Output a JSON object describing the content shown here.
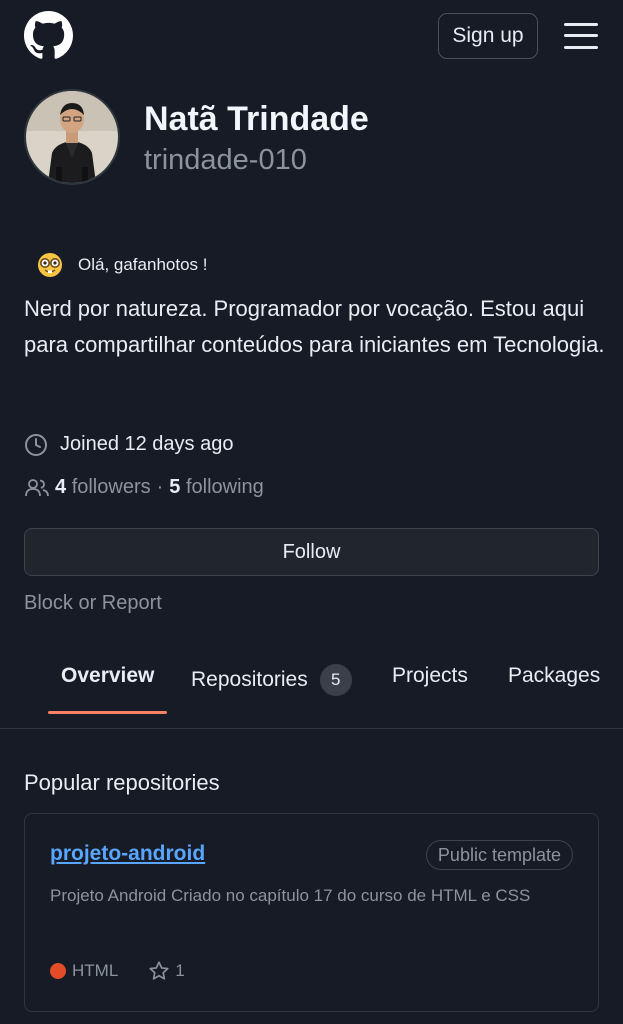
{
  "header": {
    "logo_icon": "github-mark-icon",
    "signup_label": "Sign up",
    "menu_icon": "hamburger-menu-icon"
  },
  "profile": {
    "name": "Natã Trindade",
    "login": "trindade-010",
    "status_emoji": "nerd-face-emoji",
    "status_text": "Olá, gafanhotos !",
    "bio": "Nerd por natureza. Programador por vocação. Estou aqui para compartilhar conteúdos para iniciantes em Tecnologia.",
    "joined": "Joined 12 days ago",
    "followers_count": "4",
    "followers_label": "followers",
    "separator": "·",
    "following_count": "5",
    "following_label": "following",
    "follow_label": "Follow",
    "block_label": "Block or Report"
  },
  "tabs": [
    {
      "label": "Overview",
      "active": true
    },
    {
      "label": "Repositories",
      "count": "5"
    },
    {
      "label": "Projects"
    },
    {
      "label": "Packages"
    }
  ],
  "popular": {
    "title": "Popular repositories",
    "repos": [
      {
        "name": "projeto-android",
        "badge": "Public template",
        "description": "Projeto Android Criado no capítulo 17 do curso de HTML e CSS",
        "language": "HTML",
        "language_color": "#e34c26",
        "stars": "1"
      }
    ]
  },
  "colors": {
    "background": "#161b25",
    "link": "#58a6ff",
    "tab_underline": "#f78166",
    "muted": "#8b949e"
  }
}
